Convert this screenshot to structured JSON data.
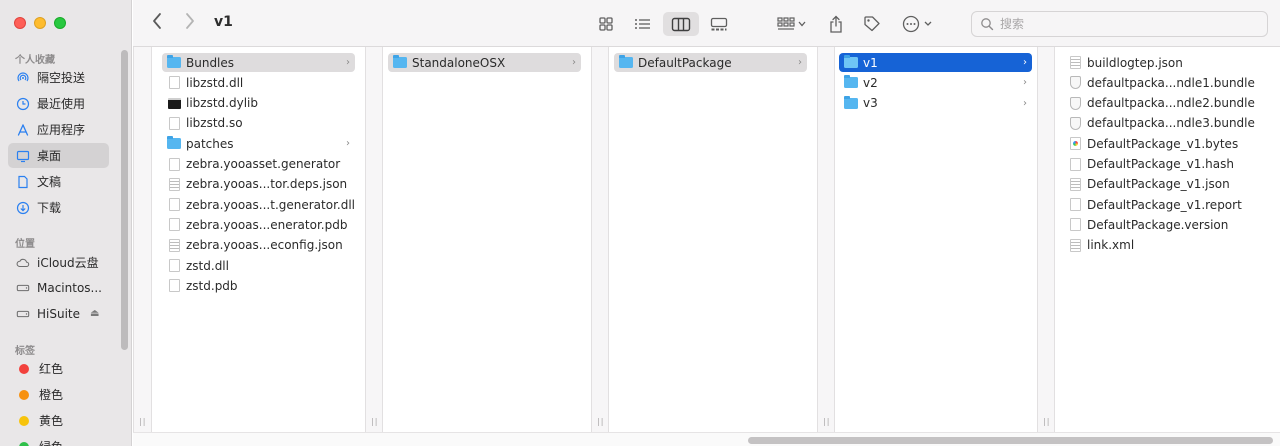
{
  "window": {
    "title": "v1"
  },
  "sidebar": {
    "sections": {
      "favorites": "个人收藏",
      "locations": "位置",
      "tags": "标签"
    },
    "favorites": [
      {
        "label": "隔空投送",
        "icon": "airdrop-icon"
      },
      {
        "label": "最近使用",
        "icon": "clock-icon"
      },
      {
        "label": "应用程序",
        "icon": "applications-icon"
      },
      {
        "label": "桌面",
        "icon": "desktop-icon",
        "active": true
      },
      {
        "label": "文稿",
        "icon": "document-icon"
      },
      {
        "label": "下载",
        "icon": "download-icon"
      }
    ],
    "locations": [
      {
        "label": "iCloud云盘",
        "icon": "cloud-icon"
      },
      {
        "label": "Macintos...",
        "icon": "disk-icon"
      },
      {
        "label": "HiSuite",
        "icon": "disk-icon"
      }
    ],
    "tags": [
      {
        "label": "红色",
        "color": "#f2413c"
      },
      {
        "label": "橙色",
        "color": "#f7900d"
      },
      {
        "label": "黄色",
        "color": "#f7c40c"
      },
      {
        "label": "绿色",
        "color": "#2fc04a"
      }
    ]
  },
  "toolbar": {
    "search_placeholder": "搜索"
  },
  "columns": [
    {
      "items": [
        {
          "name": "Bundles",
          "type": "folder",
          "selected": "gray",
          "chevron": true
        },
        {
          "name": "libzstd.dll",
          "type": "doc"
        },
        {
          "name": "libzstd.dylib",
          "type": "exec"
        },
        {
          "name": "libzstd.so",
          "type": "doc"
        },
        {
          "name": "patches",
          "type": "folder",
          "chevron": true
        },
        {
          "name": "zebra.yooasset.generator",
          "type": "doc"
        },
        {
          "name": "zebra.yooas...tor.deps.json",
          "type": "lines"
        },
        {
          "name": "zebra.yooas...t.generator.dll",
          "type": "doc"
        },
        {
          "name": "zebra.yooas...enerator.pdb",
          "type": "doc"
        },
        {
          "name": "zebra.yooas...econfig.json",
          "type": "lines"
        },
        {
          "name": "zstd.dll",
          "type": "doc"
        },
        {
          "name": "zstd.pdb",
          "type": "doc"
        }
      ]
    },
    {
      "items": [
        {
          "name": "StandaloneOSX",
          "type": "folder",
          "selected": "gray",
          "chevron": true
        }
      ]
    },
    {
      "items": [
        {
          "name": "DefaultPackage",
          "type": "folder",
          "selected": "gray",
          "chevron": true
        }
      ]
    },
    {
      "items": [
        {
          "name": "v1",
          "type": "folder",
          "selected": "blue",
          "chevron": true
        },
        {
          "name": "v2",
          "type": "folder",
          "chevron": true
        },
        {
          "name": "v3",
          "type": "folder",
          "chevron": true
        }
      ]
    },
    {
      "items": [
        {
          "name": "buildlogtep.json",
          "type": "lines"
        },
        {
          "name": "defaultpacka...ndle1.bundle",
          "type": "shield"
        },
        {
          "name": "defaultpacka...ndle2.bundle",
          "type": "shield"
        },
        {
          "name": "defaultpacka...ndle3.bundle",
          "type": "shield"
        },
        {
          "name": "DefaultPackage_v1.bytes",
          "type": "colorful"
        },
        {
          "name": "DefaultPackage_v1.hash",
          "type": "doc"
        },
        {
          "name": "DefaultPackage_v1.json",
          "type": "lines"
        },
        {
          "name": "DefaultPackage_v1.report",
          "type": "doc"
        },
        {
          "name": "DefaultPackage.version",
          "type": "doc"
        },
        {
          "name": "link.xml",
          "type": "lines"
        }
      ]
    }
  ]
}
